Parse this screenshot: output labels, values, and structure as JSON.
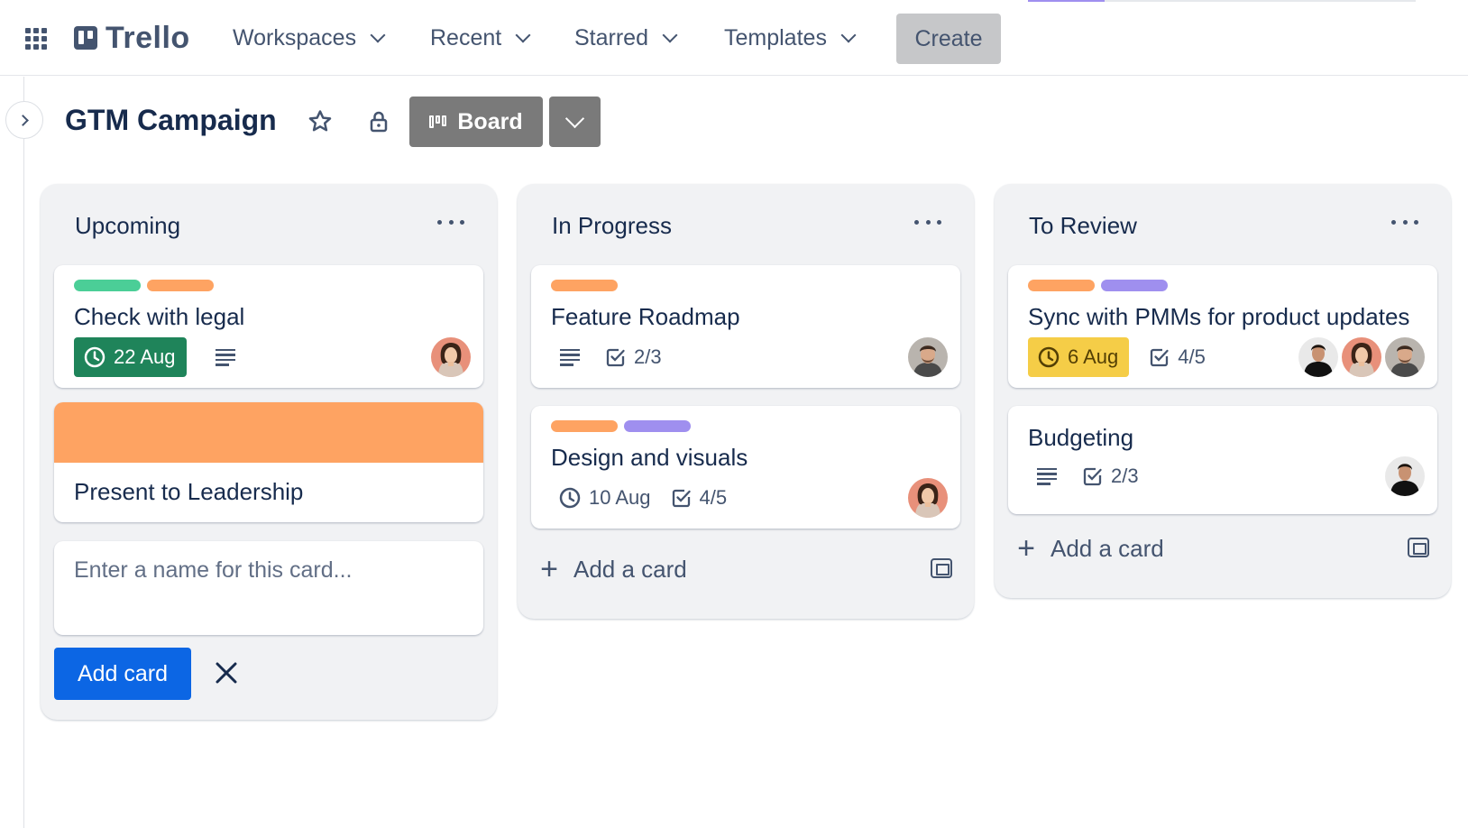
{
  "nav": {
    "logo": "Trello",
    "items": [
      {
        "label": "Workspaces",
        "icon": "chevron-down-icon"
      },
      {
        "label": "Recent",
        "icon": "chevron-down-icon"
      },
      {
        "label": "Starred",
        "icon": "chevron-down-icon"
      },
      {
        "label": "Templates",
        "icon": "chevron-down-icon"
      }
    ],
    "create_label": "Create"
  },
  "board": {
    "title": "GTM Campaign",
    "view_label": "Board"
  },
  "colors": {
    "green_label": "#4bce97",
    "orange_label": "#fea362",
    "purple_label": "#9f8fef",
    "cover_orange": "#fea362",
    "due_green": "#1f845a",
    "due_yellow": "#f5cd47",
    "primary_blue": "#0c66e4"
  },
  "lists": [
    {
      "title": "Upcoming",
      "cards": [
        {
          "title": "Check with legal",
          "labels": [
            "green",
            "orange"
          ],
          "due": "22 Aug",
          "due_style": "complete",
          "has_description": true,
          "members": 1
        },
        {
          "title": "Present to Leadership",
          "cover": "orange"
        }
      ],
      "composer": {
        "placeholder": "Enter a name for this card...",
        "add_label": "Add card"
      }
    },
    {
      "title": "In Progress",
      "cards": [
        {
          "title": "Feature Roadmap",
          "labels": [
            "orange"
          ],
          "has_description": true,
          "checklist": "2/3",
          "members": 1
        },
        {
          "title": "Design and visuals",
          "labels": [
            "orange",
            "purple"
          ],
          "due": "10 Aug",
          "checklist": "4/5",
          "members": 1
        }
      ],
      "add_card_label": "Add a card"
    },
    {
      "title": "To Review",
      "cards": [
        {
          "title": "Sync with PMMs for product updates",
          "labels": [
            "orange",
            "purple"
          ],
          "due": "6 Aug",
          "due_style": "due-soon",
          "checklist": "4/5",
          "members": 3
        },
        {
          "title": "Budgeting",
          "has_description": true,
          "checklist": "2/3",
          "members": 1
        }
      ],
      "add_card_label": "Add a card"
    }
  ]
}
